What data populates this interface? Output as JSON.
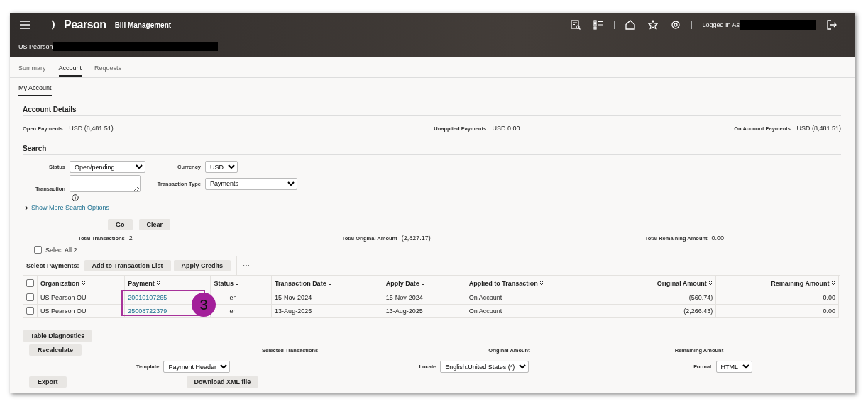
{
  "header": {
    "brand": "Pearson",
    "app_title": "Bill Management",
    "org_label": "US Pearson",
    "user_label": "Logged In As"
  },
  "tabs": [
    {
      "label": "Summary",
      "selected": false
    },
    {
      "label": "Account",
      "selected": true
    },
    {
      "label": "Requests",
      "selected": false
    }
  ],
  "subtabs": [
    {
      "label": "My Account",
      "selected": true
    }
  ],
  "account_details": {
    "title": "Account Details",
    "items": [
      {
        "label": "Open Payments:",
        "value": "USD (8,481.51)"
      },
      {
        "label": "Unapplied Payments:",
        "value": "USD 0.00"
      },
      {
        "label": "On Account Payments:",
        "value": "USD (8,481.51)"
      }
    ]
  },
  "search": {
    "title": "Search",
    "status": {
      "label": "Status",
      "value": "Open/pending"
    },
    "currency": {
      "label": "Currency",
      "value": "USD"
    },
    "transaction": {
      "label": "Transaction"
    },
    "transaction_type": {
      "label": "Transaction Type",
      "value": "Payments"
    },
    "more_link": "Show More Search Options",
    "buttons": [
      "Go",
      "Clear"
    ]
  },
  "totals": [
    {
      "label": "Total Transactions",
      "value": "2"
    },
    {
      "label": "Total Original Amount",
      "value": "(2,827.17)"
    },
    {
      "label": "Total Remaining Amount",
      "value": "0.00"
    }
  ],
  "select_all": {
    "label": "Select All 2",
    "checked": false
  },
  "toolbar": {
    "label": "Select Payments:",
    "buttons": [
      "Add to Transaction List",
      "Apply Credits"
    ],
    "more": "···"
  },
  "table": {
    "header_checked": false,
    "columns": [
      "Organization",
      "Payment",
      "Status",
      "Transaction Date",
      "Apply Date",
      "Applied to Transaction",
      "Original Amount",
      "Remaining Amount"
    ],
    "rows": [
      {
        "checked": false,
        "cells": [
          "US Pearson OU",
          "20010107265",
          "en",
          "15-Nov-2024",
          "15-Nov-2024",
          "On Account",
          "(560.74)",
          "0.00"
        ]
      },
      {
        "checked": false,
        "cells": [
          "US Pearson OU",
          "25008722379",
          "en",
          "13-Aug-2025",
          "13-Aug-2025",
          "On Account",
          "(2,266.43)",
          "0.00"
        ]
      }
    ]
  },
  "callout": {
    "number": "3"
  },
  "footer": {
    "diagnostics": "Table Diagnostics",
    "recalculate": "Recalculate",
    "summary_labels": [
      "Selected Transactions",
      "Original Amount",
      "Remaining Amount"
    ],
    "template": {
      "label": "Template",
      "value": "Payment Header"
    },
    "locale": {
      "label": "Locale",
      "value": "English:United States (*)"
    },
    "format": {
      "label": "Format",
      "value": "HTML"
    },
    "export": "Export",
    "download": "Download XML file"
  }
}
